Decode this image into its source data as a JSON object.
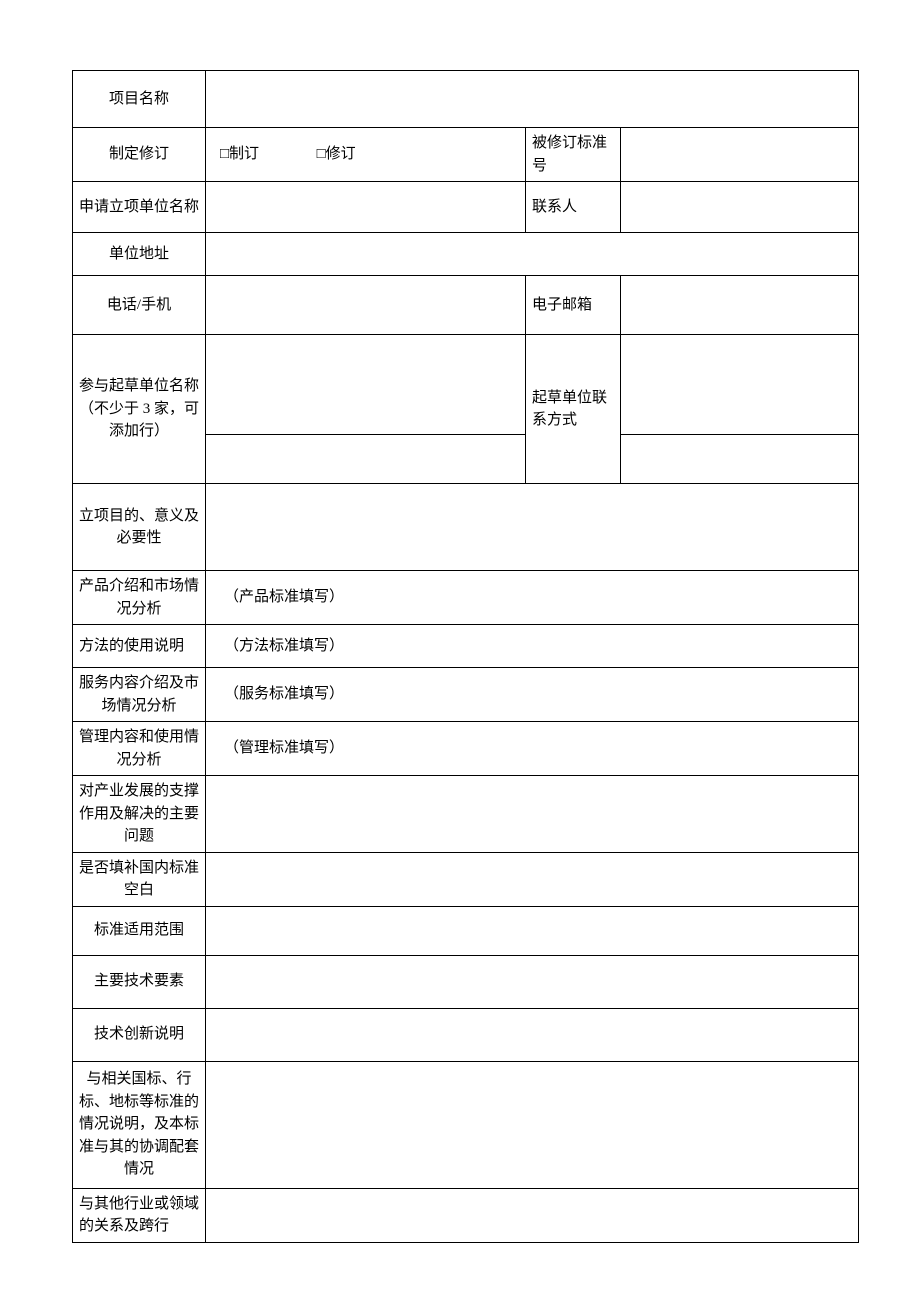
{
  "rows": {
    "project_name": {
      "label": "项目名称",
      "value": ""
    },
    "make_revise": {
      "label": "制定修订",
      "opt1": "□制订",
      "opt2": "□修订",
      "rev_label": "被修订标准号",
      "rev_value": ""
    },
    "applicant": {
      "label": "申请立项单位名称",
      "value": "",
      "contact_label": "联系人",
      "contact_value": ""
    },
    "address": {
      "label": "单位地址",
      "value": ""
    },
    "phone": {
      "label": "电话/手机",
      "value": "",
      "email_label": "电子邮箱",
      "email_value": ""
    },
    "drafters": {
      "label": "参与起草单位名称（不少于 3 家，可添加行）",
      "name1": "",
      "name2": "",
      "contact_label": "起草单位联系方式",
      "contact1": "",
      "contact2": ""
    },
    "purpose": {
      "label": "立项目的、意义及必要性",
      "value": ""
    },
    "product": {
      "label": "产品介绍和市场情况分析",
      "note": "（产品标准填写）"
    },
    "method": {
      "label": "方法的使用说明",
      "note": "（方法标准填写）"
    },
    "service": {
      "label": "服务内容介绍及市场情况分析",
      "note": "（服务标准填写）"
    },
    "management": {
      "label": "管理内容和使用情况分析",
      "note": "（管理标准填写）"
    },
    "industry_support": {
      "label": "对产业发展的支撑作用及解决的主要问题",
      "value": ""
    },
    "fill_gap": {
      "label": "是否填补国内标准空白",
      "value": ""
    },
    "scope": {
      "label": "标准适用范围",
      "value": ""
    },
    "tech_elements": {
      "label": "主要技术要素",
      "value": ""
    },
    "innovation": {
      "label": "技术创新说明",
      "value": ""
    },
    "relation_std": {
      "label": "与相关国标、行标、地标等标准的情况说明，及本标准与其的协调配套情况",
      "value": ""
    },
    "relation_industry": {
      "label": "与其他行业或领域的关系及跨行",
      "value": ""
    }
  }
}
